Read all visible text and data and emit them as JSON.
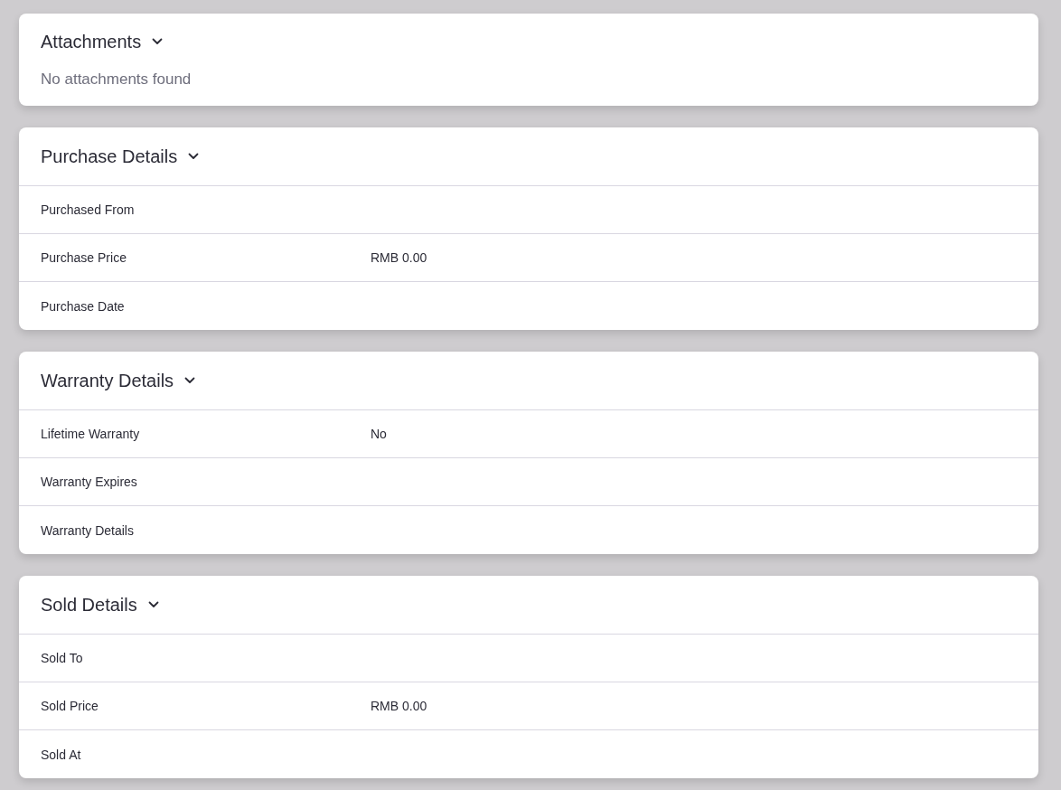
{
  "sections": [
    {
      "title": "Attachments",
      "expanded": true,
      "kind": "message",
      "message": "No attachments found"
    },
    {
      "title": "Purchase Details",
      "expanded": true,
      "kind": "fields",
      "fields": [
        {
          "label": "Purchased From"
        },
        {
          "label": "Purchase Price",
          "value": "RMB 0.00"
        },
        {
          "label": "Purchase Date"
        }
      ]
    },
    {
      "title": "Warranty Details",
      "expanded": true,
      "kind": "fields",
      "fields": [
        {
          "label": "Lifetime Warranty",
          "value": "No"
        },
        {
          "label": "Warranty Expires"
        },
        {
          "label": "Warranty Details"
        }
      ]
    },
    {
      "title": "Sold Details",
      "expanded": true,
      "kind": "fields",
      "fields": [
        {
          "label": "Sold To"
        },
        {
          "label": "Sold Price",
          "value": "RMB 0.00"
        },
        {
          "label": "Sold At"
        }
      ]
    }
  ]
}
